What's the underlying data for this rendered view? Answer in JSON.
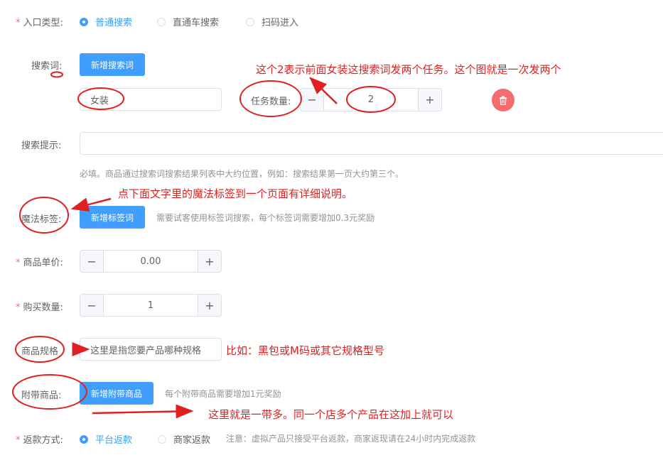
{
  "entry_type": {
    "label": "入口类型:",
    "options": [
      {
        "label": "普通搜索",
        "checked": true
      },
      {
        "label": "直通车搜索",
        "checked": false
      },
      {
        "label": "扫码进入",
        "checked": false
      }
    ]
  },
  "search_words": {
    "label": "搜索词:",
    "add_button": "新增搜索词",
    "word_value": "女装",
    "task_count_label": "任务数量:",
    "task_count_value": "2"
  },
  "search_hint": {
    "label": "搜索提示:",
    "input_value": "",
    "help_text": "必填。商品通过搜索词搜索结果列表中大约位置，例如：搜索结果第一页大约第三个。"
  },
  "magic_tags": {
    "label": "魔法标签:",
    "add_button": "新增标签词",
    "hint": "需要试客使用标签词搜索，每个标签词需要增加0.3元奖励"
  },
  "unit_price": {
    "label": "商品单价:",
    "value": "0.00"
  },
  "buy_quantity": {
    "label": "购买数量:",
    "value": "1"
  },
  "spec": {
    "label": "商品规格",
    "input_value": "这里是指您要产品哪种规格"
  },
  "attached": {
    "label": "附带商品:",
    "add_button": "新增附带商品",
    "hint": "每个附带商品需要增加1元奖励"
  },
  "refund": {
    "label": "返款方式:",
    "options": [
      {
        "label": "平台返款",
        "checked": true
      },
      {
        "label": "商家返款",
        "checked": false
      }
    ],
    "note": "注意：虚拟产品只接受平台返款，商家返现请在24小时内完成返款"
  },
  "annotations": {
    "task_count_note": "这个2表示前面女装这搜索词发两个任务。这个图就是一次发两个",
    "magic_tag_note": "点下面文字里的魔法标签到一个页面有详细说明。",
    "spec_note": "比如：黑包或M码或其它规格型号",
    "attached_note": "这里就是一带多。同一个店多个产品在这加上就可以"
  },
  "colors": {
    "primary": "#409eff",
    "danger": "#f56c6c",
    "annotation_red": "#e02020"
  }
}
